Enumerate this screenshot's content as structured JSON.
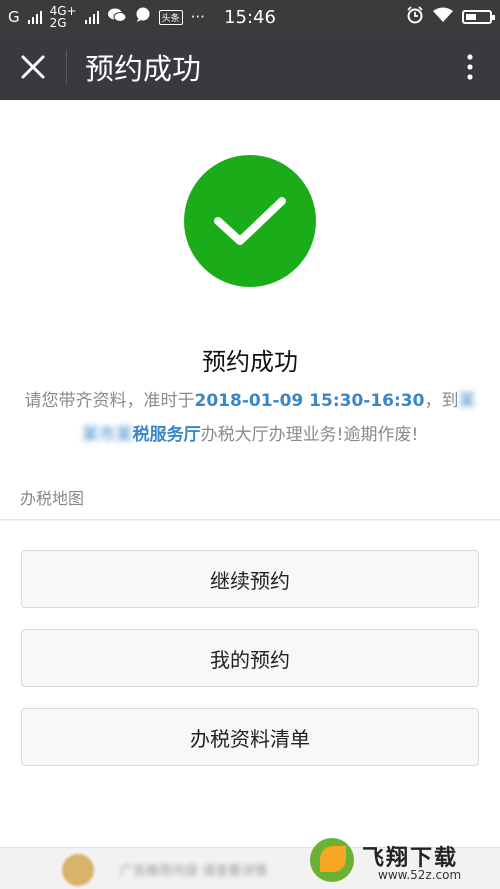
{
  "status_bar": {
    "carrier_left": "G",
    "net1": "4G+",
    "net2": "2G",
    "badge": "头条",
    "dots": "···",
    "time": "15:46"
  },
  "header": {
    "title": "预约成功"
  },
  "result": {
    "title": "预约成功",
    "line_prefix": "请您带齐资料，准时于",
    "datetime": "2018-01-09 15:30-16:30",
    "line_mid": "，到",
    "office_blurred": "某某市某",
    "office_visible": "税服务厅",
    "line_suffix": "办税大厅办理业务!逾期作废!"
  },
  "section": {
    "map_label": "办税地图"
  },
  "actions": {
    "continue_label": "继续预约",
    "my_label": "我的预约",
    "list_label": "办税资料清单"
  },
  "footer": {
    "ad_text": "广告推荐内容 请查看详情",
    "logo_text": "飞翔下载",
    "logo_sub": "www.52z.com"
  },
  "colors": {
    "success": "#1aad19",
    "link": "#3a87c8",
    "titlebar": "#393a3f"
  }
}
